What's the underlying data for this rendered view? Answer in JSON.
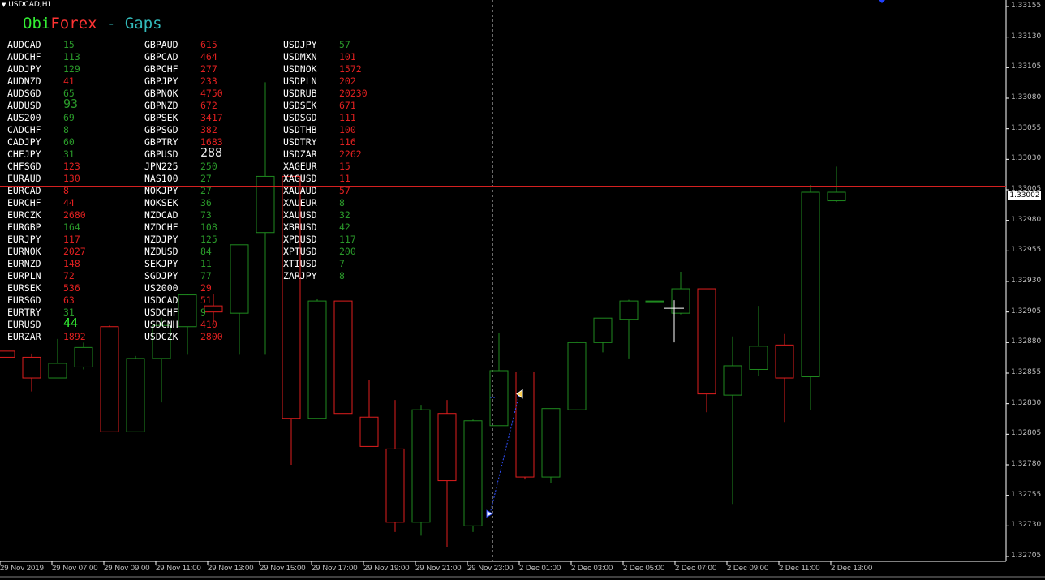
{
  "window": {
    "title": "USDCAD,H1"
  },
  "indicator": {
    "title_part1": "Obi",
    "title_part2": "Forex",
    "title_part3": " - Gaps",
    "color_part1": "#33ee33",
    "color_part2": "#ff3333",
    "color_part3": "#33bbbb"
  },
  "colors": {
    "background": "#000000",
    "bull": "#1f8a1f",
    "bear": "#e01e1e",
    "positive_value": "#2a9a2a",
    "negative_value": "#e02020",
    "neutral_value": "#e8e8e8",
    "bid_line": "#1a1aa8",
    "ask_line": "#d42020",
    "axis": "#ffffff",
    "crosshair": "#ffffff"
  },
  "gaps": {
    "columns": [
      [
        {
          "symbol": "AUDCAD",
          "value": "15",
          "color": "pos"
        },
        {
          "symbol": "AUDCHF",
          "value": "113",
          "color": "pos"
        },
        {
          "symbol": "AUDJPY",
          "value": "129",
          "color": "pos"
        },
        {
          "symbol": "AUDNZD",
          "value": "41",
          "color": "neg"
        },
        {
          "symbol": "AUDSGD",
          "value": "65",
          "color": "pos"
        },
        {
          "symbol": "AUDUSD",
          "value": "93",
          "color": "pos",
          "big": true
        },
        {
          "symbol": "AUS200",
          "value": "69",
          "color": "pos"
        },
        {
          "symbol": "CADCHF",
          "value": "8",
          "color": "pos"
        },
        {
          "symbol": "CADJPY",
          "value": "60",
          "color": "pos"
        },
        {
          "symbol": "CHFJPY",
          "value": "31",
          "color": "pos"
        },
        {
          "symbol": "CHFSGD",
          "value": "123",
          "color": "neg"
        },
        {
          "symbol": "EURAUD",
          "value": "130",
          "color": "neg"
        },
        {
          "symbol": "EURCAD",
          "value": "8",
          "color": "neg"
        },
        {
          "symbol": "EURCHF",
          "value": "44",
          "color": "neg"
        },
        {
          "symbol": "EURCZK",
          "value": "2680",
          "color": "neg"
        },
        {
          "symbol": "EURGBP",
          "value": "164",
          "color": "pos"
        },
        {
          "symbol": "EURJPY",
          "value": "117",
          "color": "neg"
        },
        {
          "symbol": "EURNOK",
          "value": "2027",
          "color": "neg"
        },
        {
          "symbol": "EURNZD",
          "value": "148",
          "color": "neg"
        },
        {
          "symbol": "EURPLN",
          "value": "72",
          "color": "neg"
        },
        {
          "symbol": "EURSEK",
          "value": "536",
          "color": "neg"
        },
        {
          "symbol": "EURSGD",
          "value": "63",
          "color": "neg"
        },
        {
          "symbol": "EURTRY",
          "value": "31",
          "color": "pos"
        },
        {
          "symbol": "EURUSD",
          "value": "44",
          "color": "bright",
          "big": true
        },
        {
          "symbol": "EURZAR",
          "value": "1892",
          "color": "neg"
        }
      ],
      [
        {
          "symbol": "GBPAUD",
          "value": "615",
          "color": "neg"
        },
        {
          "symbol": "GBPCAD",
          "value": "464",
          "color": "neg"
        },
        {
          "symbol": "GBPCHF",
          "value": "277",
          "color": "neg"
        },
        {
          "symbol": "GBPJPY",
          "value": "233",
          "color": "neg"
        },
        {
          "symbol": "GBPNOK",
          "value": "4750",
          "color": "neg"
        },
        {
          "symbol": "GBPNZD",
          "value": "672",
          "color": "neg"
        },
        {
          "symbol": "GBPSEK",
          "value": "3417",
          "color": "neg"
        },
        {
          "symbol": "GBPSGD",
          "value": "382",
          "color": "neg"
        },
        {
          "symbol": "GBPTRY",
          "value": "1683",
          "color": "neg"
        },
        {
          "symbol": "GBPUSD",
          "value": "288",
          "color": "neutral",
          "big": true
        },
        {
          "symbol": "JPN225",
          "value": "250",
          "color": "pos"
        },
        {
          "symbol": "NAS100",
          "value": "27",
          "color": "pos"
        },
        {
          "symbol": "NOKJPY",
          "value": "27",
          "color": "pos"
        },
        {
          "symbol": "NOKSEK",
          "value": "36",
          "color": "pos"
        },
        {
          "symbol": "NZDCAD",
          "value": "73",
          "color": "pos"
        },
        {
          "symbol": "NZDCHF",
          "value": "108",
          "color": "pos"
        },
        {
          "symbol": "NZDJPY",
          "value": "125",
          "color": "pos"
        },
        {
          "symbol": "NZDUSD",
          "value": "84",
          "color": "pos"
        },
        {
          "symbol": "SEKJPY",
          "value": "11",
          "color": "pos"
        },
        {
          "symbol": "SGDJPY",
          "value": "77",
          "color": "pos"
        },
        {
          "symbol": "US2000",
          "value": "29",
          "color": "neg"
        },
        {
          "symbol": "USDCAD",
          "value": "51",
          "color": "neg"
        },
        {
          "symbol": "USDCHF",
          "value": "9",
          "color": "pos"
        },
        {
          "symbol": "USDCNH",
          "value": "410",
          "color": "neg"
        },
        {
          "symbol": "USDCZK",
          "value": "2800",
          "color": "neg"
        }
      ],
      [
        {
          "symbol": "USDJPY",
          "value": "57",
          "color": "pos"
        },
        {
          "symbol": "USDMXN",
          "value": "101",
          "color": "neg"
        },
        {
          "symbol": "USDNOK",
          "value": "1572",
          "color": "neg"
        },
        {
          "symbol": "USDPLN",
          "value": "202",
          "color": "neg"
        },
        {
          "symbol": "USDRUB",
          "value": "20230",
          "color": "neg"
        },
        {
          "symbol": "USDSEK",
          "value": "671",
          "color": "neg"
        },
        {
          "symbol": "USDSGD",
          "value": "111",
          "color": "neg"
        },
        {
          "symbol": "USDTHB",
          "value": "100",
          "color": "neg"
        },
        {
          "symbol": "USDTRY",
          "value": "116",
          "color": "neg"
        },
        {
          "symbol": "USDZAR",
          "value": "2262",
          "color": "neg"
        },
        {
          "symbol": "XAGEUR",
          "value": "15",
          "color": "neg"
        },
        {
          "symbol": "XAGUSD",
          "value": "11",
          "color": "neg"
        },
        {
          "symbol": "XAUAUD",
          "value": "57",
          "color": "neg"
        },
        {
          "symbol": "XAUEUR",
          "value": "8",
          "color": "pos"
        },
        {
          "symbol": "XAUUSD",
          "value": "32",
          "color": "pos"
        },
        {
          "symbol": "XBRUSD",
          "value": "42",
          "color": "pos"
        },
        {
          "symbol": "XPDUSD",
          "value": "117",
          "color": "pos"
        },
        {
          "symbol": "XPTUSD",
          "value": "200",
          "color": "pos"
        },
        {
          "symbol": "XTIUSD",
          "value": "7",
          "color": "pos"
        },
        {
          "symbol": "ZARJPY",
          "value": "8",
          "color": "pos"
        }
      ]
    ]
  },
  "price_axis": {
    "labels": [
      "1.33155",
      "1.33130",
      "1.33105",
      "1.33080",
      "1.33055",
      "1.33030",
      "1.33005",
      "1.32980",
      "1.32955",
      "1.32930",
      "1.32905",
      "1.32880",
      "1.32855",
      "1.32830",
      "1.32805",
      "1.32780",
      "1.32755",
      "1.32730",
      "1.32705"
    ],
    "ymax": 1.33155,
    "ymin": 1.32705,
    "current_price": "1.33002"
  },
  "time_axis": {
    "labels": [
      "29 Nov 2019",
      "29 Nov 07:00",
      "29 Nov 09:00",
      "29 Nov 11:00",
      "29 Nov 13:00",
      "29 Nov 15:00",
      "29 Nov 17:00",
      "29 Nov 19:00",
      "29 Nov 21:00",
      "29 Nov 23:00",
      "2 Dec 01:00",
      "2 Dec 03:00",
      "2 Dec 05:00",
      "2 Dec 07:00",
      "2 Dec 09:00",
      "2 Dec 11:00",
      "2 Dec 13:00"
    ]
  },
  "chart_data": {
    "type": "candlestick",
    "symbol": "USDCAD",
    "timeframe": "H1",
    "ylim": [
      1.32705,
      1.33155
    ],
    "bid": 1.33002,
    "ask": 1.33008,
    "candles": [
      {
        "o": 1.32873,
        "h": 1.32873,
        "l": 1.32873,
        "c": 1.32868
      },
      {
        "o": 1.32868,
        "h": 1.32871,
        "l": 1.3284,
        "c": 1.32851
      },
      {
        "o": 1.32851,
        "h": 1.32883,
        "l": 1.32851,
        "c": 1.32863
      },
      {
        "o": 1.3286,
        "h": 1.3288,
        "l": 1.32858,
        "c": 1.32876
      },
      {
        "o": 1.32893,
        "h": 1.32894,
        "l": 1.32807,
        "c": 1.32807
      },
      {
        "o": 1.32807,
        "h": 1.32869,
        "l": 1.32807,
        "c": 1.32867
      },
      {
        "o": 1.32867,
        "h": 1.329,
        "l": 1.32831,
        "c": 1.32894
      },
      {
        "o": 1.32893,
        "h": 1.3292,
        "l": 1.3287,
        "c": 1.32919
      },
      {
        "o": 1.3291,
        "h": 1.3292,
        "l": 1.32895,
        "c": 1.32905
      },
      {
        "o": 1.32904,
        "h": 1.3296,
        "l": 1.3287,
        "c": 1.3296
      },
      {
        "o": 1.3297,
        "h": 1.33093,
        "l": 1.3287,
        "c": 1.33016
      },
      {
        "o": 1.33016,
        "h": 1.33016,
        "l": 1.3278,
        "c": 1.32818
      },
      {
        "o": 1.32818,
        "h": 1.32916,
        "l": 1.32818,
        "c": 1.32914
      },
      {
        "o": 1.32914,
        "h": 1.32914,
        "l": 1.32823,
        "c": 1.32822
      },
      {
        "o": 1.32819,
        "h": 1.32849,
        "l": 1.32795,
        "c": 1.32795
      },
      {
        "o": 1.32793,
        "h": 1.32833,
        "l": 1.32725,
        "c": 1.32733
      },
      {
        "o": 1.32733,
        "h": 1.32829,
        "l": 1.32722,
        "c": 1.32825
      },
      {
        "o": 1.32822,
        "h": 1.32833,
        "l": 1.32713,
        "c": 1.32767
      },
      {
        "o": 1.3273,
        "h": 1.32817,
        "l": 1.32725,
        "c": 1.32816
      },
      {
        "o": 1.32812,
        "h": 1.32888,
        "l": 1.32812,
        "c": 1.32857
      },
      {
        "o": 1.32856,
        "h": 1.32856,
        "l": 1.32768,
        "c": 1.3277
      },
      {
        "o": 1.3277,
        "h": 1.32826,
        "l": 1.32765,
        "c": 1.32826
      },
      {
        "o": 1.32825,
        "h": 1.32881,
        "l": 1.32825,
        "c": 1.3288
      },
      {
        "o": 1.3288,
        "h": 1.329,
        "l": 1.32872,
        "c": 1.329
      },
      {
        "o": 1.32899,
        "h": 1.32915,
        "l": 1.32867,
        "c": 1.32914
      },
      {
        "o": 1.32914,
        "h": 1.32914,
        "l": 1.32914,
        "c": 1.32914
      },
      {
        "o": 1.32904,
        "h": 1.32938,
        "l": 1.32903,
        "c": 1.32924
      },
      {
        "o": 1.32924,
        "h": 1.32924,
        "l": 1.32823,
        "c": 1.32838
      },
      {
        "o": 1.32837,
        "h": 1.32885,
        "l": 1.32748,
        "c": 1.32861
      },
      {
        "o": 1.32858,
        "h": 1.3291,
        "l": 1.32853,
        "c": 1.32877
      },
      {
        "o": 1.32878,
        "h": 1.32887,
        "l": 1.32815,
        "c": 1.32851
      },
      {
        "o": 1.32852,
        "h": 1.33009,
        "l": 1.32825,
        "c": 1.33003
      },
      {
        "o": 1.32996,
        "h": 1.33024,
        "l": 1.32995,
        "c": 1.33003
      }
    ],
    "crosshair_price": 1.32908,
    "arrow_from": 1.3274,
    "arrow_to": 1.32838
  }
}
